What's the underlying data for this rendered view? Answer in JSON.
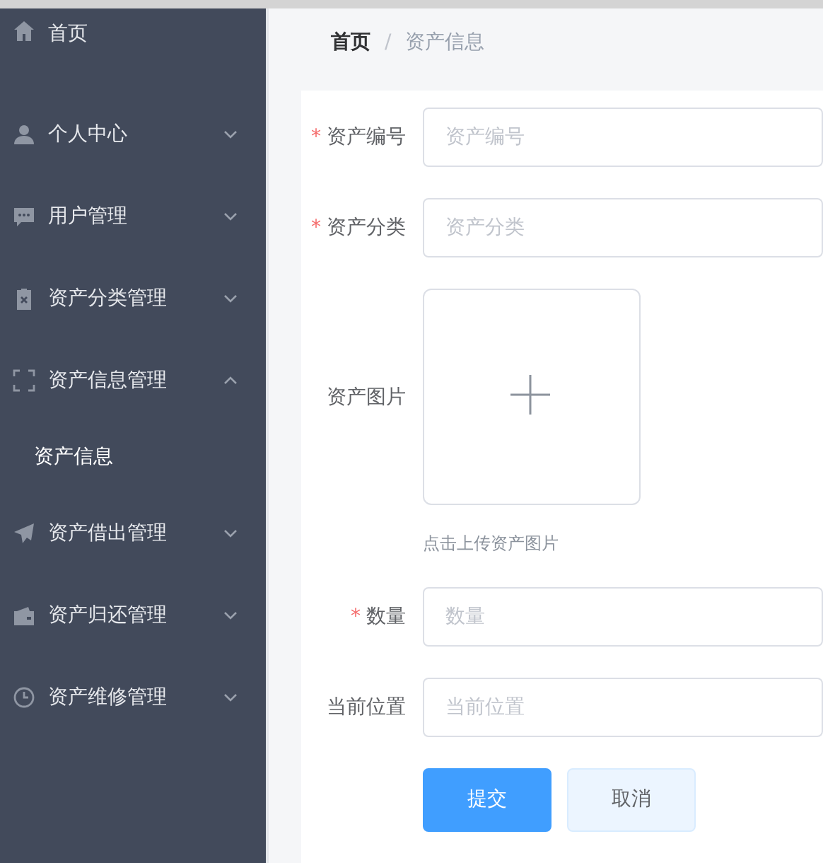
{
  "sidebar": {
    "items": [
      {
        "label": "首页"
      },
      {
        "label": "个人中心",
        "expanded": false
      },
      {
        "label": "用户管理",
        "expanded": false
      },
      {
        "label": "资产分类管理",
        "expanded": false
      },
      {
        "label": "资产信息管理",
        "expanded": true,
        "children": [
          {
            "label": "资产信息"
          }
        ]
      },
      {
        "label": "资产借出管理",
        "expanded": false
      },
      {
        "label": "资产归还管理",
        "expanded": false
      },
      {
        "label": "资产维修管理",
        "expanded": false
      }
    ]
  },
  "breadcrumb": {
    "items": [
      "首页",
      "资产信息"
    ],
    "separator": "/"
  },
  "form": {
    "fields": [
      {
        "kind": "input",
        "label": "资产编号",
        "required_mark": "*",
        "placeholder": "资产编号"
      },
      {
        "kind": "input",
        "label": "资产分类",
        "required_mark": "*",
        "placeholder": "资产分类"
      },
      {
        "kind": "upload",
        "label": "资产图片",
        "hint": "点击上传资产图片"
      },
      {
        "kind": "input",
        "label": "数量",
        "required_mark": "*",
        "placeholder": "数量"
      },
      {
        "kind": "input",
        "label": "当前位置",
        "placeholder": "当前位置"
      }
    ],
    "buttons": [
      {
        "label": "提交",
        "kind": "primary"
      },
      {
        "label": "取消",
        "kind": "secondary"
      }
    ]
  }
}
